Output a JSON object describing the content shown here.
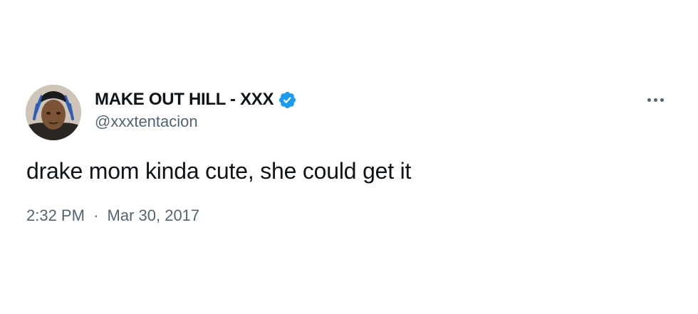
{
  "tweet": {
    "author": {
      "display_name": "MAKE OUT HILL - XXX",
      "handle": "@xxxtentacion",
      "verified": true,
      "verified_color": "#1d9bf0",
      "avatar_icon": "profile-photo"
    },
    "text": "drake mom kinda cute, she could get it",
    "time": "2:32 PM",
    "separator": "·",
    "date": "Mar 30, 2017",
    "more_icon": "ellipsis-icon"
  },
  "colors": {
    "text_primary": "#0f1419",
    "text_secondary": "#536471",
    "background": "#ffffff",
    "accent": "#1d9bf0"
  }
}
